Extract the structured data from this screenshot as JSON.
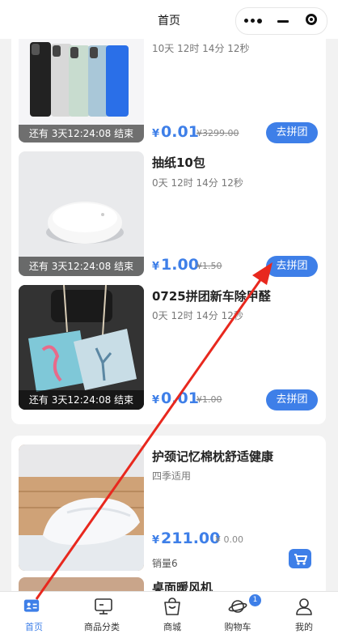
{
  "header": {
    "title": "首页"
  },
  "group_deals": [
    {
      "countdown": "10天 12时 14分 12秒",
      "timer": "还有 3天12:24:08 结束",
      "currency": "¥",
      "price": "0.01",
      "original": "¥3299.00",
      "button": "去拼团",
      "image": "phones-photo"
    },
    {
      "name": "抽纸10包",
      "countdown": "0天 12时 14分 12秒",
      "timer": "还有 3天12:24:08 结束",
      "currency": "¥",
      "price": "1.00",
      "original": "¥1.50",
      "button": "去拼团",
      "image": "round-device-photo"
    },
    {
      "name": "0725拼团新车除甲醛",
      "countdown": "0天 12时 14分 12秒",
      "timer": "还有 3天12:24:08 结束",
      "currency": "¥",
      "price": "0.01",
      "original": "¥1.00",
      "button": "去拼团",
      "image": "sachet-photo"
    }
  ],
  "products": [
    {
      "name": "护颈记忆棉枕舒适健康",
      "subtitle": "四季适用",
      "currency": "¥",
      "price": "211.00",
      "original": "¥ 0.00",
      "sales": "销量6",
      "cart_icon": "cart-icon",
      "image": "pillow-photo"
    },
    {
      "name": "桌面暖风机"
    }
  ],
  "tabbar": {
    "items": [
      {
        "label": "首页",
        "icon": "home-card-icon",
        "active": true
      },
      {
        "label": "商品分类",
        "icon": "monitor-icon"
      },
      {
        "label": "商城",
        "icon": "bag-icon"
      },
      {
        "label": "购物车",
        "icon": "planet-icon",
        "badge": "1"
      },
      {
        "label": "我的",
        "icon": "user-icon"
      }
    ]
  },
  "colors": {
    "accent": "#3e7fe8",
    "annotation_arrow": "#e8281e"
  }
}
